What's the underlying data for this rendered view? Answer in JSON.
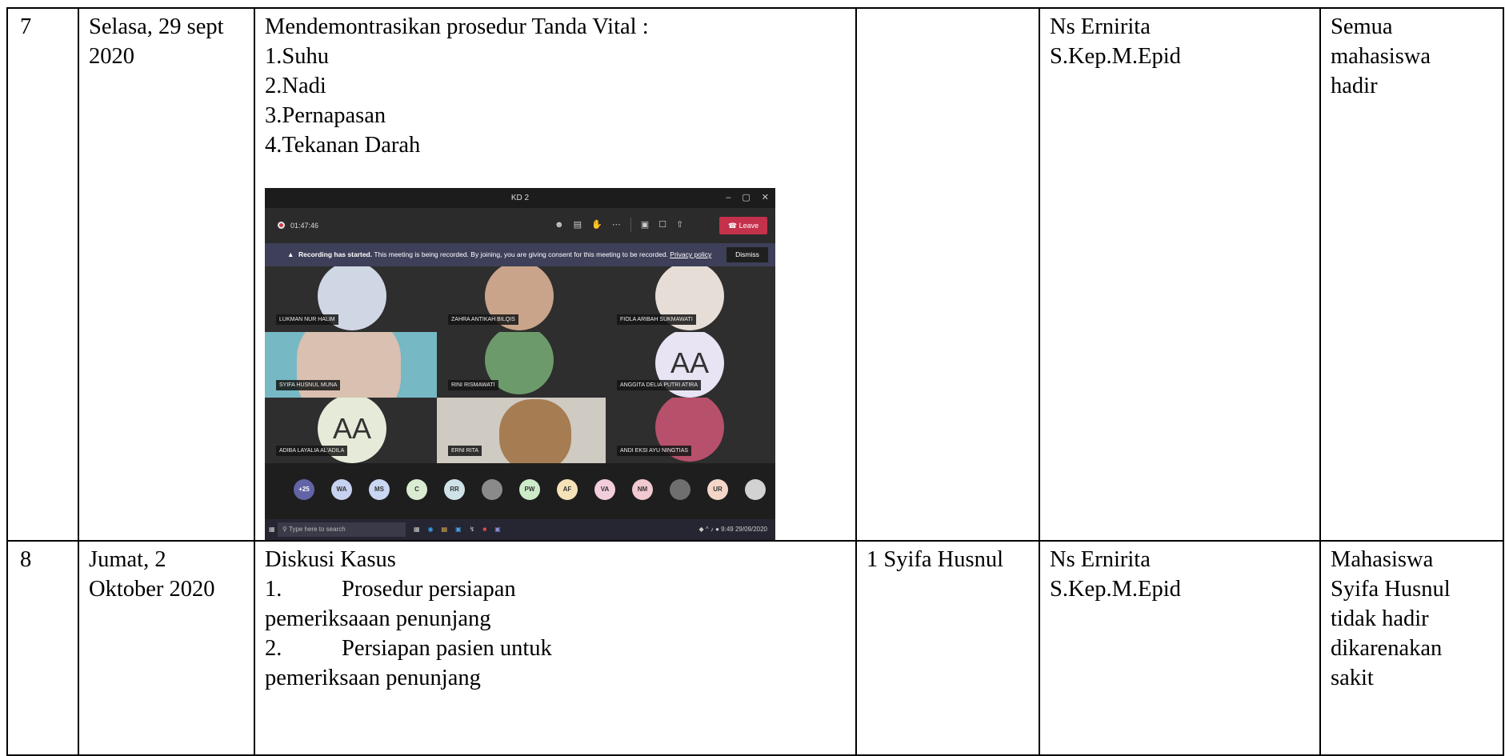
{
  "rows": [
    {
      "no": "7",
      "date": "Selasa, 29 sept 2020",
      "activity_lines": [
        "Mendemontrasikan prosedur  Tanda Vital :",
        "1.Suhu",
        "2.Nadi",
        "3.Pernapasan",
        "4.Tekanan Darah"
      ],
      "absent": "",
      "lecturer_lines": [
        "Ns Ernirita",
        "S.Kep.M.Epid"
      ],
      "remark_lines": [
        "Semua",
        "mahasiswa",
        "hadir"
      ]
    },
    {
      "no": "8",
      "date": "Jumat, 2 Oktober 2020",
      "activity_lines": [
        {
          "num": "",
          "text": "Diskusi Kasus"
        },
        {
          "num": "1.",
          "text": "Prosedur persiapan"
        },
        {
          "num": "",
          "text": "pemeriksaaan penunjang"
        },
        {
          "num": "2.",
          "text": "Persiapan pasien untuk"
        },
        {
          "num": "",
          "text": "pemeriksaan penunjang"
        }
      ],
      "absent": "1 Syifa Husnul",
      "lecturer_lines": [
        "Ns Ernirita",
        "S.Kep.M.Epid"
      ],
      "remark_lines": [
        "Mahasiswa",
        "Syifa Husnul",
        "tidak hadir",
        "dikarenakan",
        "sakit"
      ]
    }
  ],
  "meeting": {
    "window_title": "KD 2",
    "window_controls": [
      "–",
      "▢",
      "✕"
    ],
    "timer": "01:47:46",
    "leave_label": "Leave",
    "banner_bold": "Recording has started.",
    "banner_text": "This meeting is being recorded. By joining, you are giving consent for this meeting to be recorded.",
    "banner_link": "Privacy policy",
    "dismiss_label": "Dismiss",
    "participants": [
      {
        "name": "LUKMAN NUR HALIM",
        "style": "photo",
        "color": "#cfd6e4"
      },
      {
        "name": "ZAHRA ANTIKAH BILQIS",
        "style": "photo",
        "color": "#c9a48a"
      },
      {
        "name": "FIOLA ARIBAH SUKMAWATI",
        "style": "photo",
        "color": "#e6ddd6"
      },
      {
        "name": "SYIFA HUSNUL MUNA",
        "style": "photo",
        "color": "#76b8c4"
      },
      {
        "name": "RINI RISMAWATI",
        "style": "photo",
        "color": "#6d9a6b"
      },
      {
        "name": "ANGGITA DELIA PUTRI ATIRA",
        "style": "initials",
        "initials": "AA",
        "color": "#e8e4f4"
      },
      {
        "name": "ADIBA LAYALIA AL'ADILA",
        "style": "initials",
        "initials": "AA",
        "color": "#e6ead8"
      },
      {
        "name": "ERNI RITA",
        "style": "photo",
        "color": "#a67c52"
      },
      {
        "name": "ANDI EKSI AYU NINGTIAS",
        "style": "photo",
        "color": "#b7506a"
      }
    ],
    "roster": [
      {
        "label": "+25",
        "color": "#6264a7"
      },
      {
        "label": "WA",
        "color": "#c7d2f0"
      },
      {
        "label": "MS",
        "color": "#c9d7f2"
      },
      {
        "label": "C",
        "color": "#d9ecd1"
      },
      {
        "label": "RR",
        "color": "#cfe2e8"
      },
      {
        "label": "",
        "color": "#8a8a8a"
      },
      {
        "label": "PW",
        "color": "#cdebc9"
      },
      {
        "label": "AF",
        "color": "#f5e2b8"
      },
      {
        "label": "VA",
        "color": "#f2cddb"
      },
      {
        "label": "NM",
        "color": "#f1c9d1"
      },
      {
        "label": "",
        "color": "#6f6f6f"
      },
      {
        "label": "UR",
        "color": "#f4d6c8"
      },
      {
        "label": "",
        "color": "#d2d2d2"
      }
    ],
    "taskbar_search": "Type here to search",
    "tray_time": "9:49",
    "tray_date": "29/09/2020"
  }
}
